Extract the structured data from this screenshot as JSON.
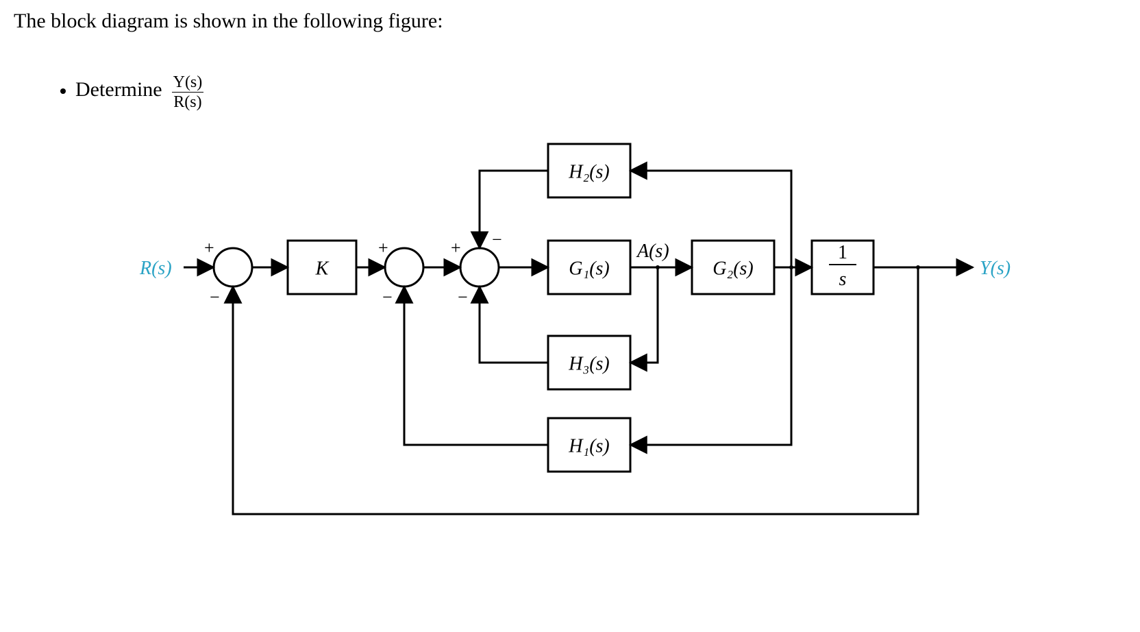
{
  "intro_text": "The block diagram is shown in the following figure:",
  "bullet": {
    "word": "Determine",
    "frac_num": "Y(s)",
    "frac_den": "R(s)"
  },
  "diagram": {
    "input_label": "R(s)",
    "output_label": "Y(s)",
    "midsignal_label": "A(s)",
    "blocks": {
      "K": "K",
      "G1": "G₁(s)",
      "G2": "G₂(s)",
      "H1": "H₁(s)",
      "H2": "H₂(s)",
      "H3": "H₃(s)",
      "integrator_num": "1",
      "integrator_den": "s"
    },
    "signs": {
      "sum1_top": "+",
      "sum1_bot": "−",
      "sum2_top": "+",
      "sum2_bot": "−",
      "sum3_top_left": "+",
      "sum3_top_right": "−",
      "sum3_bot": "−"
    }
  }
}
